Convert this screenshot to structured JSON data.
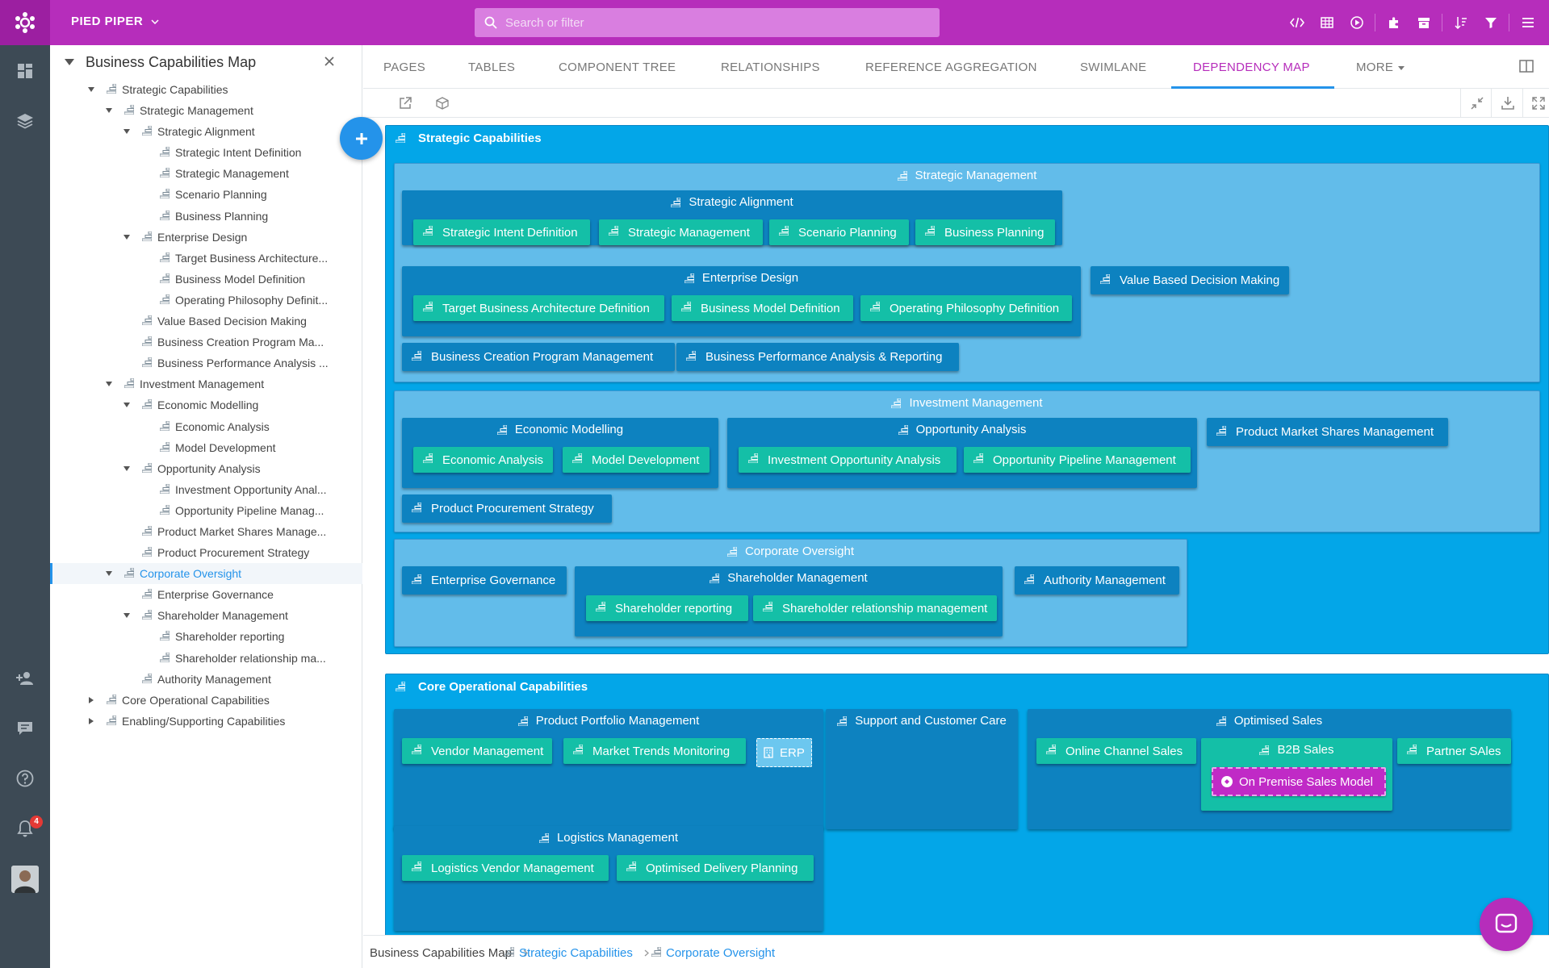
{
  "app": {
    "workspace": "PIED PIPER",
    "search_placeholder": "Search or filter",
    "notification_count": "4",
    "brand_color": "#b62dbb",
    "accent_color": "#2493ea"
  },
  "sidebar": {
    "title": "Business Capabilities Map",
    "tree": [
      {
        "label": "Strategic Capabilities",
        "depth": 0,
        "toggle": "open"
      },
      {
        "label": "Strategic Management",
        "depth": 1,
        "toggle": "open"
      },
      {
        "label": "Strategic Alignment",
        "depth": 2,
        "toggle": "open"
      },
      {
        "label": "Strategic Intent Definition",
        "depth": 3,
        "toggle": "none"
      },
      {
        "label": "Strategic Management",
        "depth": 3,
        "toggle": "none"
      },
      {
        "label": "Scenario Planning",
        "depth": 3,
        "toggle": "none"
      },
      {
        "label": "Business Planning",
        "depth": 3,
        "toggle": "none"
      },
      {
        "label": "Enterprise Design",
        "depth": 2,
        "toggle": "open"
      },
      {
        "label": "Target Business Architecture...",
        "depth": 3,
        "toggle": "none"
      },
      {
        "label": "Business Model Definition",
        "depth": 3,
        "toggle": "none"
      },
      {
        "label": "Operating Philosophy Definit...",
        "depth": 3,
        "toggle": "none"
      },
      {
        "label": "Value Based Decision Making",
        "depth": 2,
        "toggle": "none"
      },
      {
        "label": "Business Creation Program Ma...",
        "depth": 2,
        "toggle": "none"
      },
      {
        "label": "Business Performance Analysis ...",
        "depth": 2,
        "toggle": "none"
      },
      {
        "label": "Investment Management",
        "depth": 1,
        "toggle": "open"
      },
      {
        "label": "Economic Modelling",
        "depth": 2,
        "toggle": "open"
      },
      {
        "label": "Economic Analysis",
        "depth": 3,
        "toggle": "none"
      },
      {
        "label": "Model Development",
        "depth": 3,
        "toggle": "none"
      },
      {
        "label": "Opportunity Analysis",
        "depth": 2,
        "toggle": "open"
      },
      {
        "label": "Investment Opportunity Anal...",
        "depth": 3,
        "toggle": "none"
      },
      {
        "label": "Opportunity Pipeline Manag...",
        "depth": 3,
        "toggle": "none"
      },
      {
        "label": "Product Market Shares Manage...",
        "depth": 2,
        "toggle": "none"
      },
      {
        "label": "Product Procurement Strategy",
        "depth": 2,
        "toggle": "none"
      },
      {
        "label": "Corporate Oversight",
        "depth": 1,
        "toggle": "open",
        "selected": true
      },
      {
        "label": "Enterprise Governance",
        "depth": 2,
        "toggle": "none"
      },
      {
        "label": "Shareholder Management",
        "depth": 2,
        "toggle": "open"
      },
      {
        "label": "Shareholder reporting",
        "depth": 3,
        "toggle": "none"
      },
      {
        "label": "Shareholder relationship ma...",
        "depth": 3,
        "toggle": "none"
      },
      {
        "label": "Authority Management",
        "depth": 2,
        "toggle": "none"
      },
      {
        "label": "Core Operational Capabilities",
        "depth": 0,
        "toggle": "closed"
      },
      {
        "label": "Enabling/Supporting Capabilities",
        "depth": 0,
        "toggle": "closed"
      }
    ]
  },
  "tabs": [
    {
      "label": "PAGES",
      "active": false
    },
    {
      "label": "TABLES",
      "active": false
    },
    {
      "label": "COMPONENT TREE",
      "active": false
    },
    {
      "label": "RELATIONSHIPS",
      "active": false
    },
    {
      "label": "REFERENCE AGGREGATION",
      "active": false
    },
    {
      "label": "SWIMLANE",
      "active": false
    },
    {
      "label": "DEPENDENCY MAP",
      "active": true
    },
    {
      "label": "MORE",
      "active": false,
      "dropdown": true
    }
  ],
  "map": {
    "nodes": [
      {
        "label": "Strategic Capabilities",
        "kind": "top"
      },
      {
        "label": "Strategic Management",
        "kind": "l2"
      },
      {
        "label": "Strategic Alignment",
        "kind": "l3"
      },
      {
        "label": "Strategic Intent Definition",
        "kind": "leaf"
      },
      {
        "label": "Strategic Management",
        "kind": "leaf"
      },
      {
        "label": "Scenario Planning",
        "kind": "leaf"
      },
      {
        "label": "Business Planning",
        "kind": "leaf"
      },
      {
        "label": "Enterprise Design",
        "kind": "l3"
      },
      {
        "label": "Target Business Architecture Definition",
        "kind": "leaf"
      },
      {
        "label": "Business Model Definition",
        "kind": "leaf"
      },
      {
        "label": "Operating Philosophy Definition",
        "kind": "leaf"
      },
      {
        "label": "Value Based Decision Making",
        "kind": "l3"
      },
      {
        "label": "Business Creation Program Management",
        "kind": "l3"
      },
      {
        "label": "Business Performance Analysis & Reporting",
        "kind": "l3"
      },
      {
        "label": "Investment Management",
        "kind": "l2"
      },
      {
        "label": "Economic Modelling",
        "kind": "l3"
      },
      {
        "label": "Economic Analysis",
        "kind": "leaf"
      },
      {
        "label": "Model Development",
        "kind": "leaf"
      },
      {
        "label": "Opportunity Analysis",
        "kind": "l3"
      },
      {
        "label": "Investment Opportunity Analysis",
        "kind": "leaf"
      },
      {
        "label": "Opportunity Pipeline Management",
        "kind": "leaf"
      },
      {
        "label": "Product Market Shares Management",
        "kind": "l3"
      },
      {
        "label": "Product Procurement Strategy",
        "kind": "l3"
      },
      {
        "label": "Corporate Oversight",
        "kind": "l2"
      },
      {
        "label": "Enterprise Governance",
        "kind": "l3"
      },
      {
        "label": "Shareholder Management",
        "kind": "l3"
      },
      {
        "label": "Shareholder reporting",
        "kind": "leaf"
      },
      {
        "label": "Shareholder relationship management",
        "kind": "leaf"
      },
      {
        "label": "Authority Management",
        "kind": "l3"
      },
      {
        "label": "Core Operational Capabilities",
        "kind": "top"
      },
      {
        "label": "Product Portfolio Management",
        "kind": "l3"
      },
      {
        "label": "Vendor Management",
        "kind": "leaf"
      },
      {
        "label": "Market Trends Monitoring",
        "kind": "leaf"
      },
      {
        "label": "ERP",
        "kind": "app"
      },
      {
        "label": "Support and Customer Care",
        "kind": "l3"
      },
      {
        "label": "Optimised Sales",
        "kind": "l3"
      },
      {
        "label": "Online Channel Sales",
        "kind": "leaf"
      },
      {
        "label": "B2B Sales",
        "kind": "leaf"
      },
      {
        "label": "On Premise Sales Model",
        "kind": "model"
      },
      {
        "label": "Partner SAles",
        "kind": "leaf"
      },
      {
        "label": "Logistics Management",
        "kind": "l3"
      },
      {
        "label": "Logistics Vendor Management",
        "kind": "leaf"
      },
      {
        "label": "Optimised Delivery Planning",
        "kind": "leaf"
      }
    ],
    "colors": {
      "top": "#03a6e8",
      "l2": "#62bcea",
      "l3": "#0d82c0",
      "leaf": "#14bfa7",
      "model": "#c02ac6",
      "app": "#6cc7ef"
    }
  },
  "breadcrumb": [
    {
      "label": "Business Capabilities Map",
      "link": false
    },
    {
      "label": "Strategic Capabilities",
      "link": true
    },
    {
      "label": "Corporate Oversight",
      "link": true
    }
  ],
  "icons": {
    "top": [
      "code-icon",
      "table-icon",
      "play-icon",
      "puzzle-icon",
      "archive-icon",
      "sort-icon",
      "filter-icon",
      "menu-icon"
    ],
    "rail": [
      "dashboard-icon",
      "layers-icon",
      "add-user-icon",
      "comment-icon",
      "help-icon",
      "bell-icon",
      "settings-icon"
    ]
  }
}
